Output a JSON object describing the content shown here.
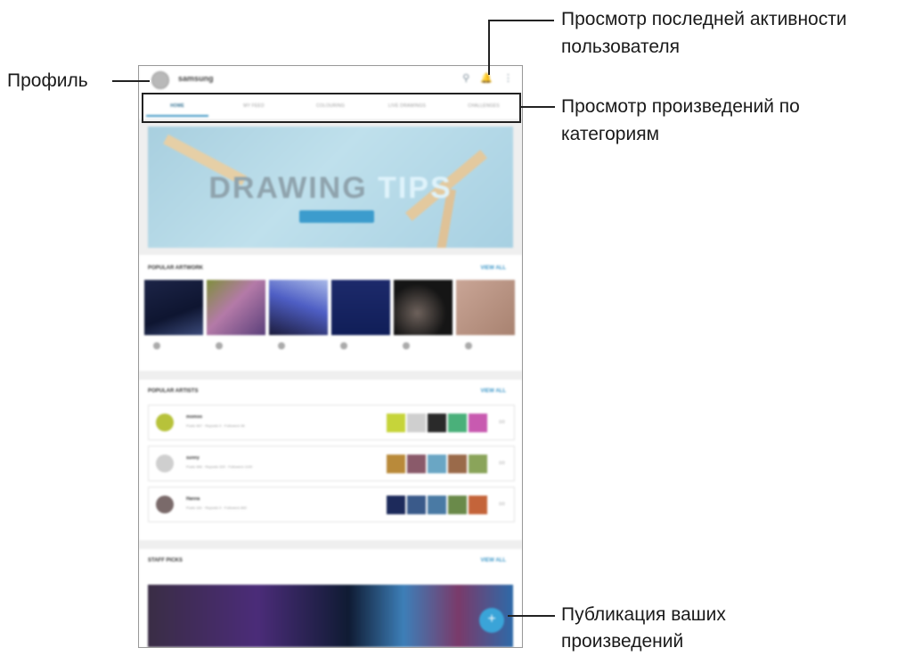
{
  "screen": {
    "username": "samsung",
    "tabs": [
      "HOME",
      "MY FEED",
      "COLOURING",
      "LIVE DRAWINGS",
      "CHALLENGES"
    ],
    "banner": {
      "title_word1": "DRAWING",
      "title_word2": "TIPS"
    },
    "sections": {
      "popular_artwork": {
        "title": "POPULAR ARTWORK",
        "view_all": "VIEW ALL"
      },
      "popular_artists": {
        "title": "POPULAR ARTISTS",
        "view_all": "VIEW ALL"
      },
      "staff_picks": {
        "title": "STAFF PICKS",
        "view_all": "VIEW ALL"
      }
    },
    "artists": [
      {
        "name": "momoo",
        "stats": "Posts 467 · Reposts 0 · Followers 98"
      },
      {
        "name": "sunny",
        "stats": "Posts 466 · Reposts 320 · Followers 1100"
      },
      {
        "name": "Hanna",
        "stats": "Posts 181 · Reposts 0 · Followers 660"
      }
    ],
    "fab_icon": "+",
    "colors": {
      "accent": "#3aa4d8"
    }
  },
  "callouts": {
    "profile": "Профиль",
    "activity_line1": "Просмотр последней активности",
    "activity_line2": "пользователя",
    "categories_line1": "Просмотр произведений по",
    "categories_line2": "категориям",
    "publish_line1": "Публикация ваших",
    "publish_line2": "произведений"
  }
}
